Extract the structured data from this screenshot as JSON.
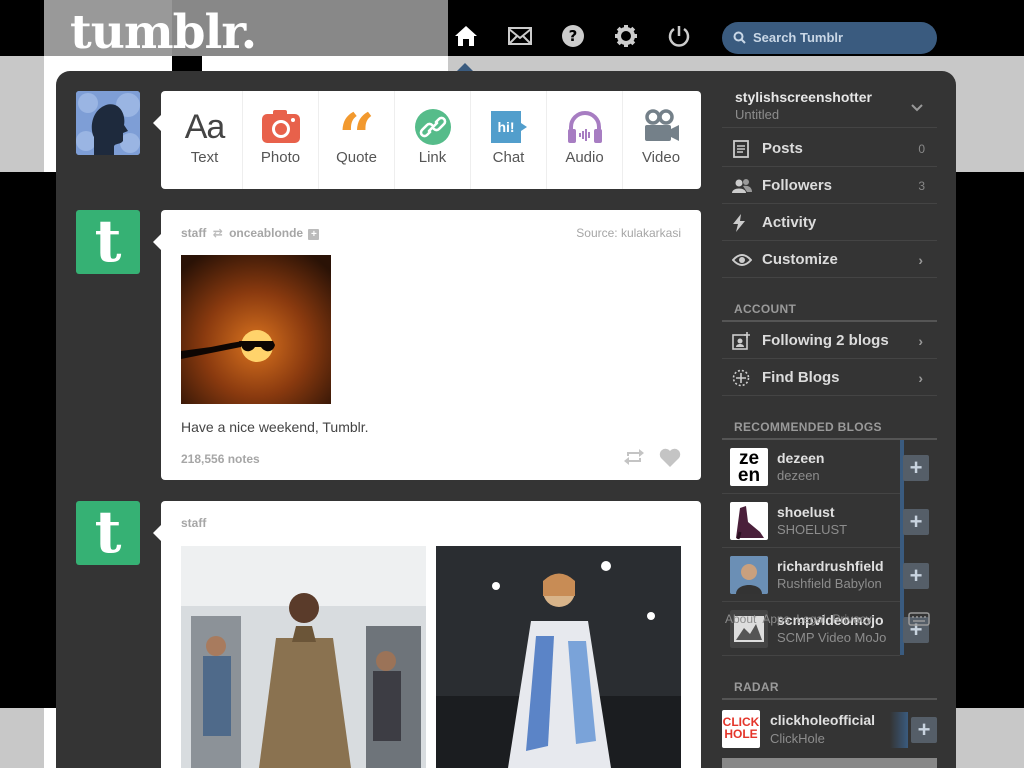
{
  "header": {
    "logo": "tumblr.",
    "search_placeholder": "Search Tumblr"
  },
  "post_types": [
    {
      "label": "Text",
      "icon": "text-icon",
      "color": "#444444"
    },
    {
      "label": "Photo",
      "icon": "camera-icon",
      "color": "#e8614b"
    },
    {
      "label": "Quote",
      "icon": "quote-icon",
      "color": "#f2992e"
    },
    {
      "label": "Link",
      "icon": "link-icon",
      "color": "#56bc8a"
    },
    {
      "label": "Chat",
      "icon": "chat-icon",
      "color": "#529ecc"
    },
    {
      "label": "Audio",
      "icon": "headphones-icon",
      "color": "#a77dc2"
    },
    {
      "label": "Video",
      "icon": "video-camera-icon",
      "color": "#748089"
    }
  ],
  "posts": [
    {
      "author": "staff",
      "reblogged_from": "onceablonde",
      "source_label": "Source:",
      "source": "kulakarkasi",
      "caption": "Have a nice weekend, Tumblr.",
      "notes": "218,556 notes"
    },
    {
      "author": "staff"
    }
  ],
  "sidebar": {
    "blog_name": "stylishscreenshotter",
    "blog_subtitle": "Untitled",
    "items": [
      {
        "label": "Posts",
        "count": "0",
        "icon": "posts-icon"
      },
      {
        "label": "Followers",
        "count": "3",
        "icon": "followers-icon"
      },
      {
        "label": "Activity",
        "icon": "bolt-icon"
      },
      {
        "label": "Customize",
        "icon": "eye-icon"
      }
    ],
    "account_heading": "ACCOUNT",
    "account_items": [
      {
        "label": "Following 2 blogs",
        "icon": "following-icon"
      },
      {
        "label": "Find Blogs",
        "icon": "compass-icon"
      }
    ],
    "recommended_heading": "RECOMMENDED BLOGS",
    "recommended": [
      {
        "name": "dezeen",
        "title": "dezeen"
      },
      {
        "name": "shoelust",
        "title": "SHOELUST"
      },
      {
        "name": "richardrushfield",
        "title": "Rushfield Babylon"
      },
      {
        "name": "scmpvideomojo",
        "title": "SCMP Video MoJo"
      }
    ],
    "overlay_footer": "About  Apps  Legal  Privacy",
    "radar_heading": "RADAR",
    "radar": {
      "name": "clickholeofficial",
      "title": "ClickHole"
    }
  },
  "colors": {
    "panel": "#343434",
    "tumblr_green": "#36b174",
    "search": "#3a5b7f"
  }
}
